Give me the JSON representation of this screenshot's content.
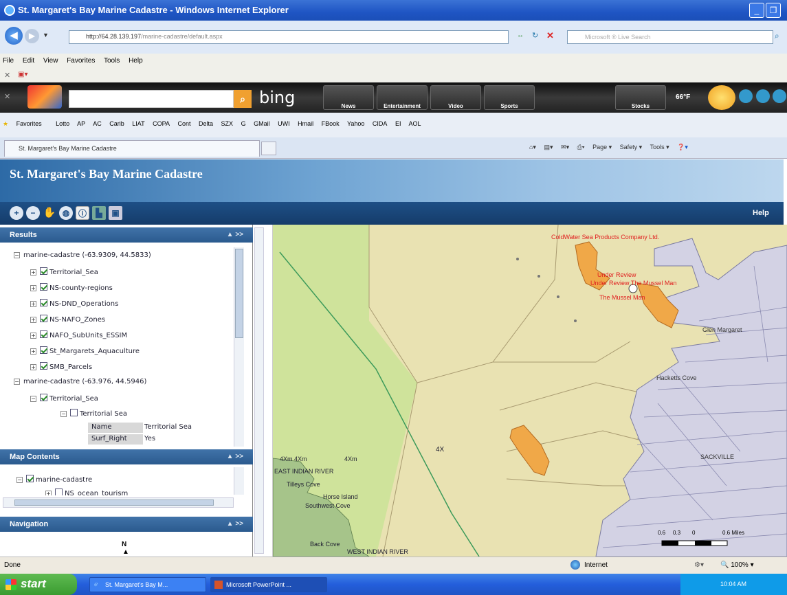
{
  "window": {
    "title": "St. Margaret's Bay Marine Cadastre - Windows Internet Explorer"
  },
  "address": {
    "url_host": "http://64.28.139.197",
    "url_path": "/marine-cadastre/default.aspx",
    "search_placeholder": "Microsoft ® Live Search"
  },
  "menu": [
    "File",
    "Edit",
    "View",
    "Favorites",
    "Tools",
    "Help"
  ],
  "bing": {
    "logo": "bing",
    "tabs": [
      "News",
      "Entertainment",
      "Video",
      "Sports",
      "Stocks"
    ],
    "temp": "66°F"
  },
  "favorites": [
    "Favorites",
    "Lotto",
    "AP",
    "AC",
    "Carib",
    "LIAT",
    "COPA",
    "Cont",
    "Delta",
    "SZX",
    "G",
    "GMail",
    "UWI",
    "Hmail",
    "FBook",
    "Yahoo",
    "CIDA",
    "EI",
    "AOL"
  ],
  "tab": {
    "label": "St. Margaret's Bay Marine Cadastre"
  },
  "commands": [
    "Page ▾",
    "Safety ▾",
    "Tools ▾"
  ],
  "app": {
    "title": "St. Margaret's Bay Marine Cadastre",
    "help": "Help"
  },
  "results": {
    "title": "Results",
    "ctl": "▲ >>",
    "group1": {
      "label": "marine-cadastre (-63.9309, 44.5833)",
      "layers": [
        "Territorial_Sea",
        "NS-county-regions",
        "NS-DND_Operations",
        "NS-NAFO_Zones",
        "NAFO_SubUnits_ESSIM",
        "St_Margarets_Aquaculture",
        "SMB_Parcels"
      ]
    },
    "group2": {
      "label": "marine-cadastre (-63.976, 44.5946)",
      "layer": "Territorial_Sea",
      "sublayer": "Territorial Sea",
      "attrs": [
        {
          "k": "Name",
          "v": "Territorial Sea"
        },
        {
          "k": "Surf_Right",
          "v": "Yes"
        }
      ]
    }
  },
  "map_contents": {
    "title": "Map Contents",
    "ctl": "▲ >>",
    "root": "marine-cadastre",
    "child": "NS_ocean_tourism"
  },
  "navigation": {
    "title": "Navigation",
    "ctl": "▲ >>",
    "north": "N"
  },
  "map": {
    "labels": {
      "coldwater": "ColdWater Sea Products Company Ltd.",
      "review1": "Under Review",
      "review2": "Under Review The Mussel Man",
      "mussel": "The Mussel Man",
      "glen": "Glen Margaret",
      "hacketts": "Hacketts Cove",
      "sackville": "SACKVILLE",
      "fourx": "4X",
      "fourxm1": "4Xm  4Xm",
      "fourxm2": "4Xm",
      "eastindian": "EAST INDIAN RIVER",
      "tilleys": "Tilleys Cove",
      "horse": "Horse Island",
      "southwest": "Southwest Cove",
      "backcove": "Back Cove",
      "westindian": "WEST INDIAN RIVER"
    },
    "scale": {
      "t0": "0.6",
      "t1": "0.3",
      "t2": "0",
      "t3": "0.6 Miles"
    },
    "colors": {
      "water": "#e9e2b2",
      "land": "#d0cfe0",
      "aquaculture": "#f0a848",
      "label_red": "#e02020"
    }
  },
  "status": {
    "text": "Done",
    "zone": "Internet",
    "zoom": "100%"
  },
  "taskbar": {
    "start": "start",
    "tasks": [
      "St. Margaret's Bay M...",
      "Microsoft PowerPoint ..."
    ],
    "clock": "10:04 AM"
  }
}
